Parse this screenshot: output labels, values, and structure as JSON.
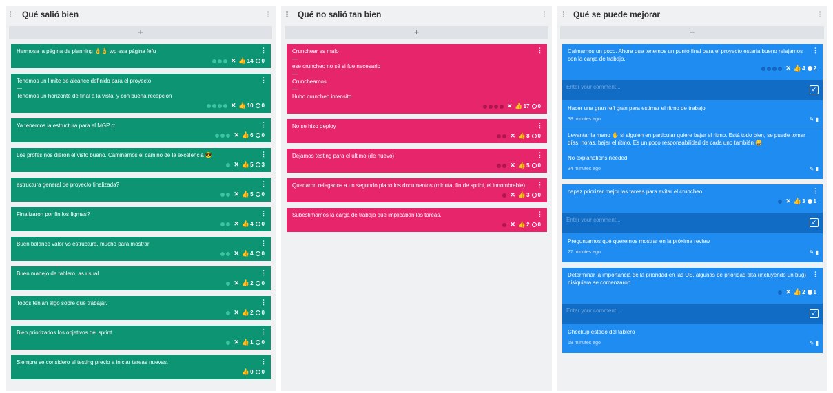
{
  "columns": [
    {
      "title": "Qué salió bien",
      "color": "#0d9473",
      "add_label": "+",
      "cards": [
        {
          "text": [
            "Hermosa la página de planning 👌👌 wp esa página fefu"
          ],
          "dots": 3,
          "showX": true,
          "likes": "14",
          "comments": "0",
          "commentFilled": false
        },
        {
          "text": [
            "Tenemos un limite de alcance definido para el proyecto",
            "—",
            "Tenemos un horizonte de final a la vista, y con buena recepcion"
          ],
          "dots": 4,
          "showX": true,
          "likes": "10",
          "comments": "0",
          "commentFilled": false
        },
        {
          "text": [
            "Ya tenemos la estructura para el MGP c:"
          ],
          "dots": 3,
          "showX": true,
          "likes": "6",
          "comments": "0",
          "commentFilled": false
        },
        {
          "text": [
            "Los profes nos dieron el visto bueno. Caminamos el camino de la excelencia 😎"
          ],
          "dots": 1,
          "showX": true,
          "likes": "5",
          "comments": "3",
          "commentFilled": false
        },
        {
          "text": [
            "estructura general de proyecto finalizada?"
          ],
          "dots": 2,
          "showX": true,
          "likes": "5",
          "comments": "0",
          "commentFilled": false
        },
        {
          "text": [
            "Finalizaron por fin los figmas?"
          ],
          "dots": 2,
          "showX": true,
          "likes": "4",
          "comments": "0",
          "commentFilled": false
        },
        {
          "text": [
            "Buen balance valor vs estructura, mucho para mostrar"
          ],
          "dots": 2,
          "showX": true,
          "likes": "4",
          "comments": "0",
          "commentFilled": false
        },
        {
          "text": [
            "Buen manejo de tablero, as usual"
          ],
          "dots": 1,
          "showX": true,
          "likes": "2",
          "comments": "0",
          "commentFilled": false
        },
        {
          "text": [
            "Todos tenian algo sobre que trabajar."
          ],
          "dots": 1,
          "showX": true,
          "likes": "2",
          "comments": "0",
          "commentFilled": false
        },
        {
          "text": [
            "Bien priorizados los objetivos del sprint."
          ],
          "dots": 1,
          "showX": true,
          "likes": "1",
          "comments": "0",
          "commentFilled": false
        },
        {
          "text": [
            "Siempre se considero el testing previo a iniciar tareas nuevas."
          ],
          "dots": 0,
          "showX": false,
          "likes": "0",
          "comments": "0",
          "commentFilled": false
        }
      ]
    },
    {
      "title": "Qué no salió tan bien",
      "color": "#e6256b",
      "add_label": "+",
      "cards": [
        {
          "text": [
            "Crunchear es malo",
            "—",
            "ese cruncheo no sé si fue necesario",
            "—",
            "Cruncheamos",
            "—",
            "Hubo cruncheo intensito"
          ],
          "dots": 4,
          "showX": true,
          "likes": "17",
          "comments": "0",
          "commentFilled": false
        },
        {
          "text": [
            "No se hizo deploy"
          ],
          "dots": 2,
          "showX": true,
          "likes": "8",
          "comments": "0",
          "commentFilled": false
        },
        {
          "text": [
            "Dejamos testing para el ultimo (de nuevo)"
          ],
          "dots": 2,
          "showX": true,
          "likes": "5",
          "comments": "0",
          "commentFilled": false
        },
        {
          "text": [
            "Quedaron relegados a un segundo plano los documentos (minuta, fin de sprint, el innombrable)"
          ],
          "dots": 1,
          "showX": true,
          "likes": "3",
          "comments": "0",
          "commentFilled": false
        },
        {
          "text": [
            "Subestimamos la carga de trabajo que implicaban las tareas."
          ],
          "dots": 1,
          "showX": true,
          "likes": "2",
          "comments": "0",
          "commentFilled": false
        }
      ]
    },
    {
      "title": "Qué se puede mejorar",
      "color": "#1e8cf0",
      "add_label": "+",
      "cards": [
        {
          "text": [
            "Calmarnos un poco. Ahora que tenemos un punto final para el proyecto estaria bueno relajarnos con la carga de trabajo."
          ],
          "dots": 4,
          "showX": true,
          "likes": "4",
          "comments": "2",
          "commentFilled": true,
          "comment_placeholder": "Enter your comment...",
          "comment_list": [
            {
              "text": [
                "Hacer una gran refi gran para estimar el ritmo de trabajo"
              ],
              "time": "38 minutes ago"
            },
            {
              "text": [
                "Levantar la mano ✋ si alguien en particular quiere bajar el ritmo. Está todo bien, se puede tomar días, horas, bajar el ritmo. Es un poco responsabilidad de cada uno también 😄",
                "",
                "No explanations needed"
              ],
              "time": "34 minutes ago"
            }
          ]
        },
        {
          "text": [
            "capaz priorizar mejor las tareas para evitar el cruncheo"
          ],
          "dots": 1,
          "showX": true,
          "likes": "3",
          "comments": "1",
          "commentFilled": true,
          "comment_placeholder": "Enter your comment...",
          "comment_list": [
            {
              "text": [
                "Preguntarnos qué queremos mostrar en la próxima review"
              ],
              "time": "27 minutes ago"
            }
          ]
        },
        {
          "text": [
            "Determinar la importancia de la prioridad en las US, algunas de prioridad alta (incluyendo un bug) nisiquiera se comenzaron"
          ],
          "dots": 1,
          "showX": true,
          "likes": "2",
          "comments": "1",
          "commentFilled": true,
          "comment_placeholder": "Enter your comment...",
          "comment_list": [
            {
              "text": [
                "Checkup estado del tablero"
              ],
              "time": "18 minutes ago"
            }
          ]
        }
      ]
    }
  ]
}
